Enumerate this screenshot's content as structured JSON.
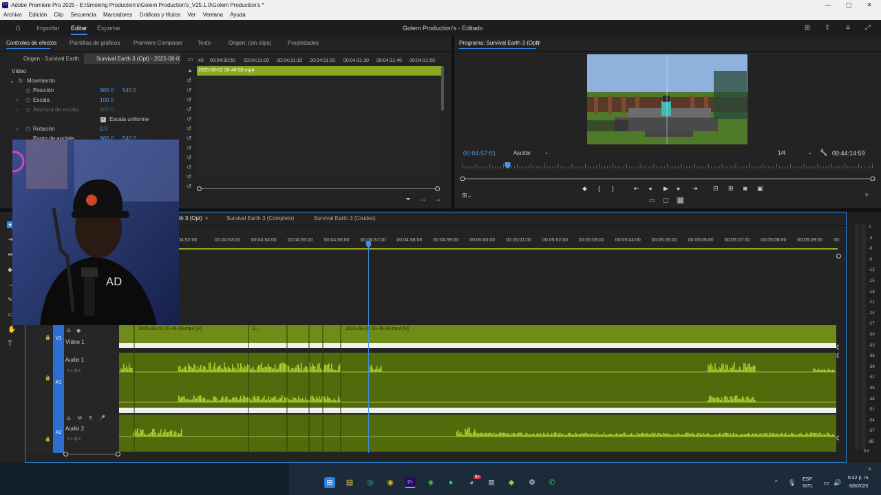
{
  "window": {
    "title": "Adobe Premiere Pro 2025 - E:\\Smoking Production's\\Golem Production's_V25.1.0\\Golem Production's *",
    "app_icon_label": "Pr",
    "controls": [
      "—",
      "▢",
      "✕"
    ]
  },
  "menu": [
    "Archivo",
    "Edición",
    "Clip",
    "Secuencia",
    "Marcadores",
    "Gráficos y títulos",
    "Ver",
    "Ventana",
    "Ayuda"
  ],
  "header": {
    "workspaces": [
      "Importar",
      "Editar",
      "Exportar"
    ],
    "active_workspace": "Editar",
    "project_status": "Golem Production's - Editado"
  },
  "top_left_panel": {
    "tabs": [
      "Controles de efectos",
      "Plantillas de gráficos",
      "Premiere Composer",
      "Texto",
      "Origen: (sin clips)",
      "Propiedades"
    ],
    "active_tab": "Controles de efectos",
    "source_chip": "Origen - Survival Earth...",
    "sequence_chip": "Survival Earth 3 (Opt) - 2025-08-02...",
    "section": "Vídeo",
    "effect_group": "Movimiento",
    "properties": [
      {
        "label": "Posición",
        "v1": "960.0",
        "v2": "540.0"
      },
      {
        "label": "Escala",
        "v1": "100.0",
        "v2": ""
      },
      {
        "label": "Anchura de escala",
        "v1": "100.0",
        "v2": ""
      },
      {
        "label": "Escala uniforme",
        "v1": "",
        "v2": ""
      },
      {
        "label": "Rotación",
        "v1": "0.0",
        "v2": ""
      },
      {
        "label": "Punto de anclaje",
        "v1": "960.0",
        "v2": "540.0"
      }
    ],
    "mini_timeline_ticks": [
      ":40",
      "00:04:30:50",
      "00:04:31:00",
      "00:04:31:10",
      "00:04:31:20",
      "00:04:31:30",
      "00:04:31:40",
      "00:04:31:50"
    ],
    "mini_clip": "2025-08-02 20-46-59.mp4"
  },
  "program_monitor": {
    "title": "Programa: Survival Earth 3 (Opt)",
    "timecode": "00:04:57:01",
    "fit": "Ajustar",
    "resolution": "1/4",
    "duration": "00:44:14:59",
    "playhead_fraction": 0.11
  },
  "timeline": {
    "tabs": [
      "th 3 (Opt)",
      "Survival Earth 3 (Completo)",
      "Survival Earth 3 (Crudos)"
    ],
    "ruler": [
      "04:52:00",
      "00:04:53:00",
      "00:04:54:00",
      "00:04:55:00",
      "00:04:56:00",
      "00:04:57:00",
      "00:04:58:00",
      "00:04:59:00",
      "00:05:00:00",
      "00:05:01:00",
      "00:05:02:00",
      "00:05:03:00",
      "00:05:04:00",
      "00:05:05:00",
      "00:05:06:00",
      "00:05:07:00",
      "00:05:08:00",
      "00:05:09:00",
      "00:"
    ],
    "tracks": [
      {
        "id": "V1",
        "name": "Vídeo 1"
      },
      {
        "id": "A1",
        "name": "Audio 1"
      },
      {
        "id": "A2",
        "name": "Audio 2"
      }
    ],
    "clips": [
      "2025-08-02 20-46-59.mp4 [V]",
      "2...",
      "2025-08-02 20-46-59.mp4 [V]"
    ],
    "track_buttons": {
      "mute": "M",
      "solo": "S"
    }
  },
  "meter": {
    "labels": [
      "0",
      "-3",
      "-6",
      "-9",
      "-12",
      "-15",
      "-18",
      "-21",
      "-24",
      "-27",
      "-30",
      "-33",
      "-36",
      "-39",
      "-42",
      "-45",
      "-48",
      "-51",
      "-54",
      "-57",
      "dB"
    ],
    "bottom": "0  0"
  },
  "taskbar": {
    "lang": "ESP",
    "layout": "INTL",
    "time": "6:42 p. m.",
    "date": "6/8/2025",
    "badge": "9+"
  },
  "colors": {
    "accent": "#2d8ceb",
    "clip_video": "#7a9a1a",
    "clip_audio": "#53700e",
    "waveform": "#a8d12a",
    "playhead": "#3f8ee8"
  }
}
